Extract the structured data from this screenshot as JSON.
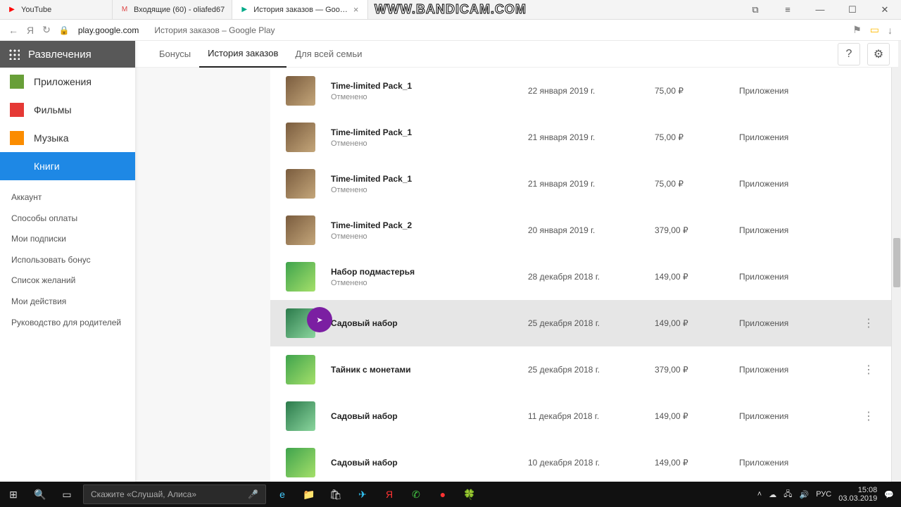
{
  "watermark": "WWW.BANDICAM.COM",
  "tabs": [
    {
      "icon": "▶",
      "icon_color": "#f00",
      "title": "YouTube"
    },
    {
      "icon": "M",
      "icon_color": "#d33",
      "title": "Входящие (60) - oliafed67"
    },
    {
      "icon": "▶",
      "icon_color": "#0a8",
      "title": "История заказов — Goo…"
    }
  ],
  "addr": {
    "host": "play.google.com",
    "title": "История заказов – Google Play"
  },
  "sidebar": {
    "header": "Развлечения",
    "items": [
      {
        "label": "Приложения",
        "cls": "ico-apps"
      },
      {
        "label": "Фильмы",
        "cls": "ico-movies"
      },
      {
        "label": "Музыка",
        "cls": "ico-music"
      },
      {
        "label": "Книги",
        "cls": "ico-books",
        "active": true
      }
    ],
    "secondary": [
      "Аккаунт",
      "Способы оплаты",
      "Мои подписки",
      "Использовать бонус",
      "Список желаний",
      "Мои действия",
      "Руководство для родителей"
    ]
  },
  "maintabs": [
    "Бонусы",
    "История заказов",
    "Для всей семьи"
  ],
  "maintab_active": 1,
  "orders": [
    {
      "title": "Time-limited Pack_1",
      "status": "Отменено",
      "date": "22 января 2019 г.",
      "price": "75,00 ₽",
      "cat": "Приложения",
      "thumb": "t1"
    },
    {
      "title": "Time-limited Pack_1",
      "status": "Отменено",
      "date": "21 января 2019 г.",
      "price": "75,00 ₽",
      "cat": "Приложения",
      "thumb": "t1"
    },
    {
      "title": "Time-limited Pack_1",
      "status": "Отменено",
      "date": "21 января 2019 г.",
      "price": "75,00 ₽",
      "cat": "Приложения",
      "thumb": "t1"
    },
    {
      "title": "Time-limited Pack_2",
      "status": "Отменено",
      "date": "20 января 2019 г.",
      "price": "379,00 ₽",
      "cat": "Приложения",
      "thumb": "t1"
    },
    {
      "title": "Набор подмастерья",
      "status": "Отменено",
      "date": "28 декабря 2018 г.",
      "price": "149,00 ₽",
      "cat": "Приложения",
      "thumb": "game2"
    },
    {
      "title": "Садовый набор",
      "status": "",
      "date": "25 декабря 2018 г.",
      "price": "149,00 ₽",
      "cat": "Приложения",
      "thumb": "game3",
      "hover": true,
      "menu": true
    },
    {
      "title": "Тайник с монетами",
      "status": "",
      "date": "25 декабря 2018 г.",
      "price": "379,00 ₽",
      "cat": "Приложения",
      "thumb": "game2",
      "menu": true
    },
    {
      "title": "Садовый набор",
      "status": "",
      "date": "11 декабря 2018 г.",
      "price": "149,00 ₽",
      "cat": "Приложения",
      "thumb": "game3",
      "menu": true
    },
    {
      "title": "Садовый набор",
      "status": "",
      "date": "10 декабря 2018 г.",
      "price": "149,00 ₽",
      "cat": "Приложения",
      "thumb": "game2"
    }
  ],
  "taskbar": {
    "search": "Скажите «Слушай, Алиса»",
    "lang": "РУС",
    "date": "03.03.2019",
    "time": "15:08"
  }
}
